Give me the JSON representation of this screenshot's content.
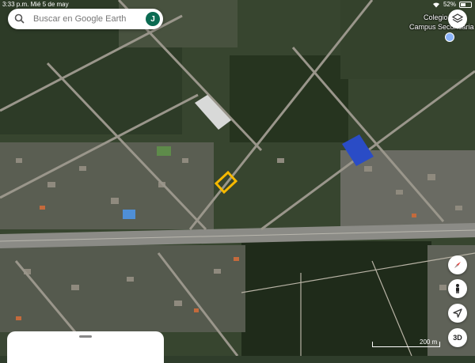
{
  "status_bar": {
    "time": "3:33 p.m.",
    "date": "Mié 5 de may",
    "battery": "52%"
  },
  "search": {
    "placeholder": "Buscar en Google Earth",
    "avatar_initial": "J"
  },
  "map": {
    "labels": [
      "Colegio",
      "Campus Secundaria"
    ],
    "scale_label": "200 m"
  },
  "controls": {
    "layers": "layers-icon",
    "compass": "compass-icon",
    "street_view": "pegman-icon",
    "my_location": "navigation-arrow-icon",
    "view_3d_label": "3D"
  },
  "colors": {
    "avatar": "#0b6b52",
    "highlight": "#f5b800",
    "court": "#2a4cc6"
  }
}
